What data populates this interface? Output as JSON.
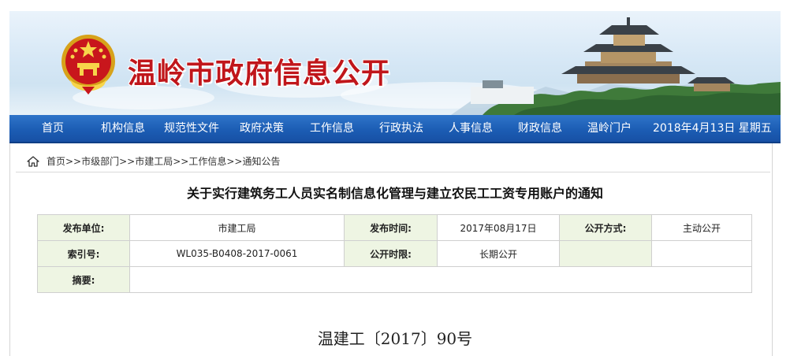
{
  "site": {
    "title": "温岭市政府信息公开",
    "emblem_icon": "national-emblem-icon",
    "title_color": "#c0161b"
  },
  "nav": {
    "items": [
      "首页",
      "机构信息",
      "规范性文件",
      "政府决策",
      "工作信息",
      "行政执法",
      "人事信息",
      "财政信息",
      "温岭门户"
    ],
    "date": "2018年4月13日 星期五",
    "color": "#1c5db4"
  },
  "breadcrumb": {
    "icon": "home-icon",
    "text": "首页>>市级部门>>市建工局>>工作信息>>通知公告"
  },
  "document": {
    "title": "关于实行建筑务工人员实名制信息化管理与建立农民工工资专用账户的通知",
    "meta": {
      "publisher_label": "发布单位:",
      "publisher_value": "市建工局",
      "date_label": "发布时间:",
      "date_value": "2017年08月17日",
      "method_label": "公开方式:",
      "method_value": "主动公开",
      "index_label": "索引号:",
      "index_value": "WL035-B0408-2017-0061",
      "period_label": "公开时限:",
      "period_value": "长期公开",
      "summary_label": "摘要:",
      "summary_value": ""
    },
    "number": "温建工〔2017〕90号"
  }
}
